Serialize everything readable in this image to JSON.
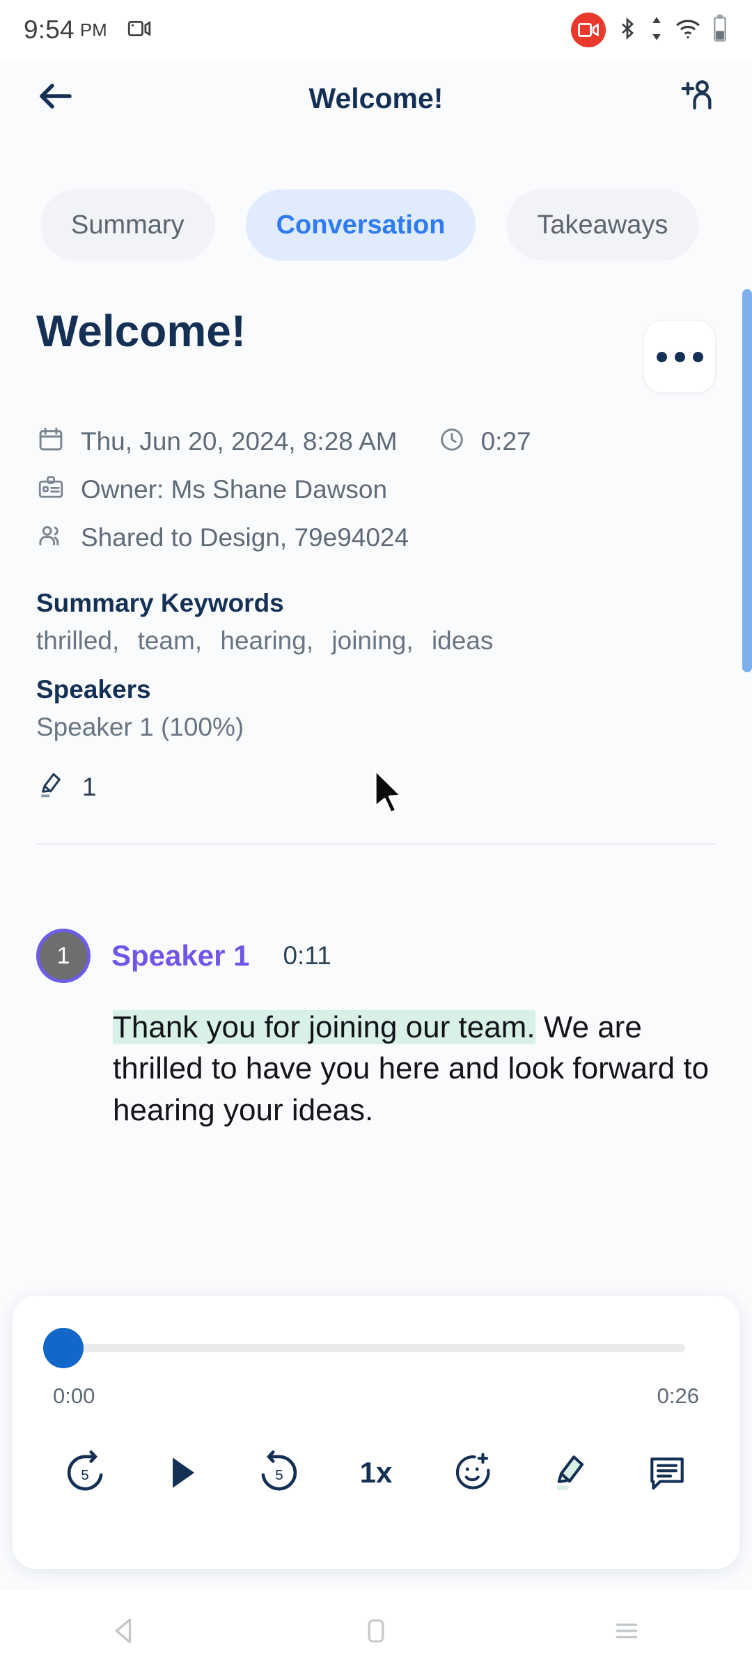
{
  "status_bar": {
    "time": "9:54",
    "ampm": "PM",
    "icons": {
      "screen_record": "screen-record-icon",
      "recording_badge": "recording-badge-icon",
      "bluetooth": "bluetooth-icon",
      "data_transfer": "data-transfer-icon",
      "wifi": "wifi-icon",
      "battery": "battery-icon"
    }
  },
  "header": {
    "back_label": "back-arrow",
    "title": "Welcome!",
    "add_person_label": "add-person"
  },
  "tabs": [
    {
      "label": "Summary",
      "active": false
    },
    {
      "label": "Conversation",
      "active": true
    },
    {
      "label": "Takeaways",
      "active": false
    }
  ],
  "document": {
    "title": "Welcome!",
    "more_label": "more-options",
    "meta": {
      "date": "Thu, Jun 20, 2024, 8:28 AM",
      "duration": "0:27",
      "owner": "Owner: Ms Shane Dawson",
      "shared": "Shared to Design, 79e94024"
    },
    "summary_keywords": {
      "heading": "Summary Keywords",
      "words": [
        "thrilled,",
        "team,",
        "hearing,",
        "joining,",
        "ideas"
      ]
    },
    "speakers": {
      "heading": "Speakers",
      "list": "Speaker 1 (100%)"
    },
    "highlight_count": "1"
  },
  "transcript": [
    {
      "avatar_initial": "1",
      "speaker": "Speaker 1",
      "time": "0:11",
      "highlighted_text": "Thank you for joining our team.",
      "rest_text": " We are thrilled to have you here and look forward to hearing your ideas."
    }
  ],
  "player": {
    "current_time": "0:00",
    "total_time": "0:26",
    "progress_percent": 0,
    "controls": {
      "rewind": "replay-5-icon",
      "play": "play-icon",
      "forward": "forward-5-icon",
      "speed": "1x",
      "reaction": "add-reaction-icon",
      "highlight": "highlighter-icon",
      "transcript": "transcript-icon"
    }
  },
  "nav_bar": {
    "back": "nav-back-icon",
    "home": "nav-home-icon",
    "recents": "nav-recents-icon"
  },
  "colors": {
    "accent_blue": "#2f7bf0",
    "tab_active_bg": "#e0ebfd",
    "title_navy": "#143055",
    "speaker_purple": "#7056e8",
    "highlight_mint": "#d8f0e5",
    "scrollbar_blue": "#7fb0ec",
    "record_red": "#e8392c",
    "slider_blue": "#1267c8"
  }
}
